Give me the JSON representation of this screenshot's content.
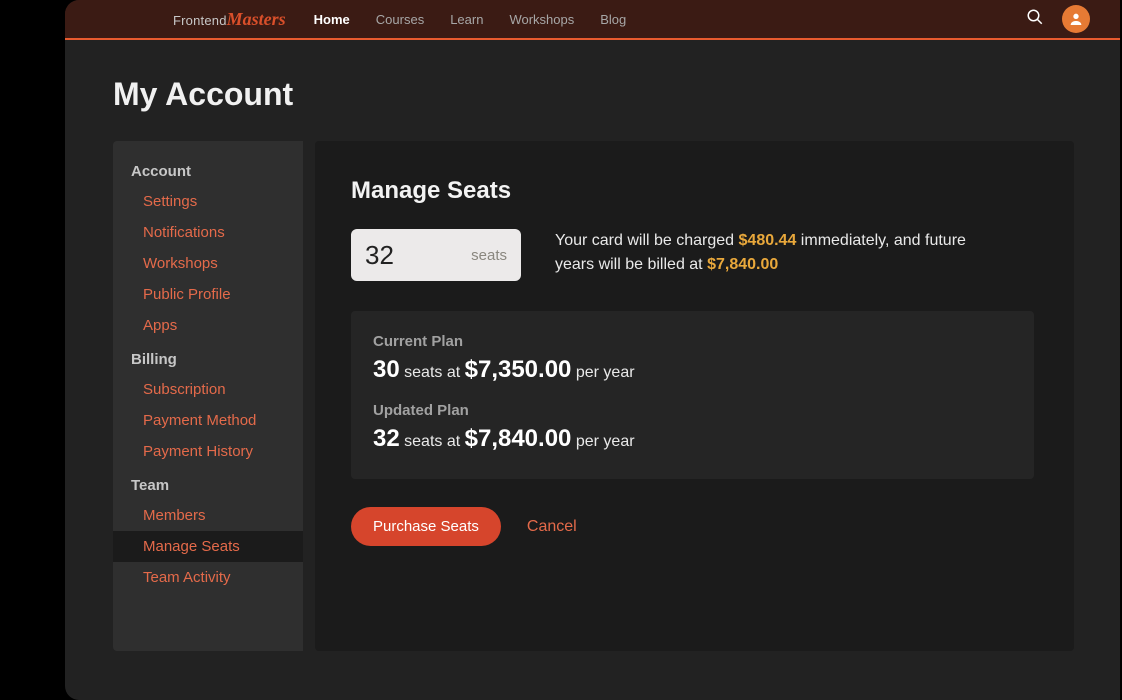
{
  "brand": {
    "part1": "Frontend",
    "part2": "Masters"
  },
  "nav": {
    "items": [
      {
        "label": "Home",
        "active": true
      },
      {
        "label": "Courses"
      },
      {
        "label": "Learn"
      },
      {
        "label": "Workshops"
      },
      {
        "label": "Blog"
      }
    ]
  },
  "page": {
    "title": "My Account"
  },
  "sidebar": {
    "sections": [
      {
        "title": "Account",
        "items": [
          {
            "label": "Settings"
          },
          {
            "label": "Notifications"
          },
          {
            "label": "Workshops"
          },
          {
            "label": "Public Profile"
          },
          {
            "label": "Apps"
          }
        ]
      },
      {
        "title": "Billing",
        "items": [
          {
            "label": "Subscription"
          },
          {
            "label": "Payment Method"
          },
          {
            "label": "Payment History"
          }
        ]
      },
      {
        "title": "Team",
        "items": [
          {
            "label": "Members"
          },
          {
            "label": "Manage Seats",
            "active": true
          },
          {
            "label": "Team Activity"
          }
        ]
      }
    ]
  },
  "main": {
    "heading": "Manage Seats",
    "seat_input_value": "32",
    "seat_suffix": "seats",
    "charge": {
      "prefix": "Your card will be charged ",
      "immediate_amount": "$480.44",
      "middle": " immediately, and future years will be billed at ",
      "annual_amount": "$7,840.00"
    },
    "current_plan": {
      "label": "Current Plan",
      "seats": "30",
      "conj": " seats at ",
      "price": "$7,350.00",
      "period": " per year"
    },
    "updated_plan": {
      "label": "Updated Plan",
      "seats": "32",
      "conj": " seats at ",
      "price": "$7,840.00",
      "period": " per year"
    },
    "purchase_label": "Purchase Seats",
    "cancel_label": "Cancel"
  }
}
